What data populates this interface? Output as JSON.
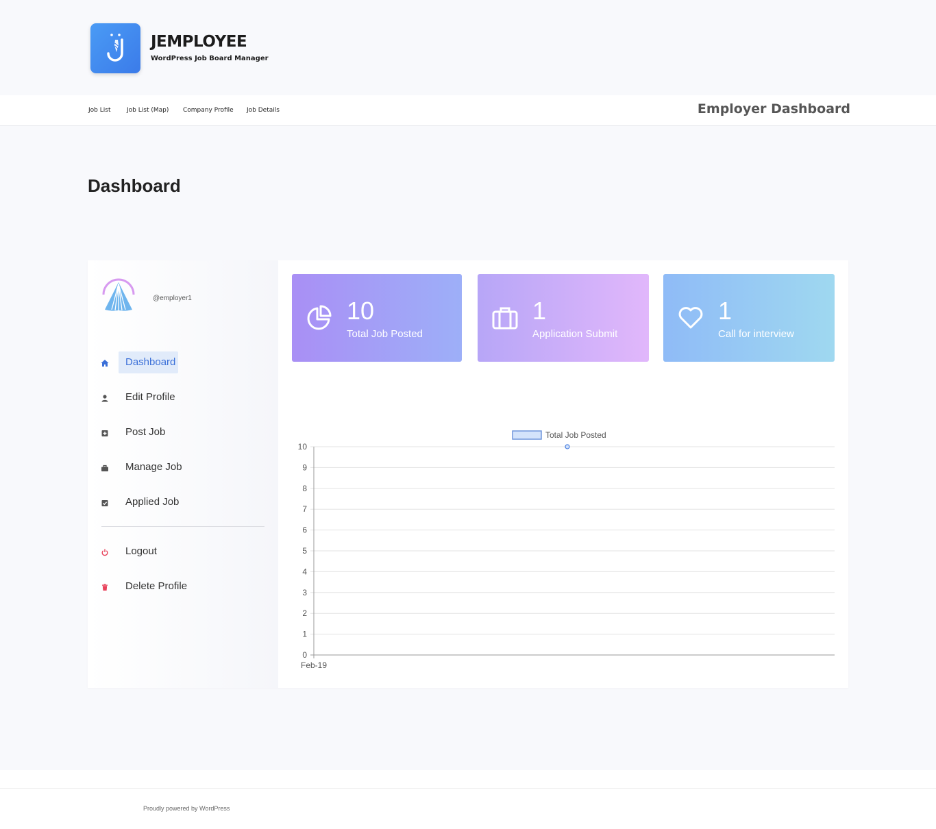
{
  "header": {
    "brand": "JEMPLOYEE",
    "tagline": "WordPress Job Board Manager"
  },
  "nav": {
    "links": [
      "Job List",
      "Job List (Map)",
      "Company Profile",
      "Job Details"
    ],
    "title": "Employer Dashboard"
  },
  "page": {
    "title": "Dashboard"
  },
  "profile": {
    "username": "@employer1"
  },
  "menu": {
    "items": [
      {
        "label": "Dashboard",
        "icon": "home-icon",
        "active": true
      },
      {
        "label": "Edit Profile",
        "icon": "user-icon"
      },
      {
        "label": "Post Job",
        "icon": "plus-square-icon"
      },
      {
        "label": "Manage Job",
        "icon": "briefcase-icon"
      },
      {
        "label": "Applied Job",
        "icon": "check-square-icon"
      },
      {
        "label": "Logout",
        "icon": "power-icon"
      },
      {
        "label": "Delete Profile",
        "icon": "trash-icon"
      }
    ]
  },
  "cards": [
    {
      "value": "10",
      "label": "Total Job Posted",
      "icon": "pie-chart-icon"
    },
    {
      "value": "1",
      "label": "Application Submit",
      "icon": "briefcase-icon"
    },
    {
      "value": "1",
      "label": "Call for interview",
      "icon": "heart-icon"
    }
  ],
  "colors": {
    "accent": "#3a6fd8",
    "logout": "#e8415a",
    "card1": [
      "#a98ff5",
      "#9daff8"
    ],
    "card2": [
      "#b7a6f7",
      "#e1b7fb"
    ],
    "card3": [
      "#8fbbf7",
      "#9fd8f0"
    ]
  },
  "chart_data": {
    "type": "line",
    "legend": [
      "Total Job Posted"
    ],
    "categories": [
      "Feb-19"
    ],
    "series": [
      {
        "name": "Total Job Posted",
        "values": [
          10
        ]
      }
    ],
    "ylim": [
      0,
      10
    ],
    "yticks": [
      0,
      1,
      2,
      3,
      4,
      5,
      6,
      7,
      8,
      9,
      10
    ],
    "grid": true,
    "legend_position": "top"
  },
  "footer": {
    "text": "Proudly powered by WordPress"
  }
}
